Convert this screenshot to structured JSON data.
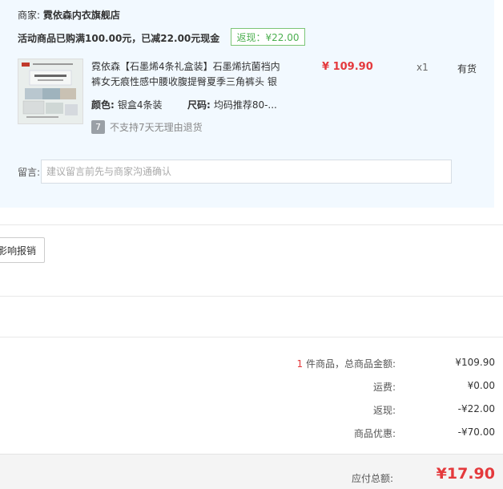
{
  "store": {
    "label": "商家:",
    "name": "霓依森内衣旗舰店"
  },
  "promo": {
    "text": "活动商品已购满100.00元，已减22.00元现金",
    "badge": "返现：¥22.00"
  },
  "product": {
    "title": "霓依森【石墨烯4条礼盒装】石墨烯抗菌裆内裤女无痕性感中腰收腹提臀夏季三角裤头 银",
    "price": "¥ 109.90",
    "qty": "x1",
    "stock": "有货",
    "color_label": "颜色:",
    "color_value": "银盒4条装",
    "size_label": "尺码:",
    "size_value": "均码推荐80-...",
    "return_icon_text": "7",
    "return_text": "不支持7天无理由退货"
  },
  "note": {
    "label": "留言:",
    "placeholder": "建议留言前先与商家沟通确认"
  },
  "invoice": {
    "button_label": "影响报销"
  },
  "summary": {
    "count": "1",
    "items_label": " 件商品，总商品金额:",
    "items_value": "¥109.90",
    "shipping_label": "运费:",
    "shipping_value": "¥0.00",
    "cashback_label": "返现:",
    "cashback_value": "-¥22.00",
    "discount_label": "商品优惠:",
    "discount_value": "-¥70.00",
    "total_label": "应付总额:",
    "total_value": "¥17.90"
  },
  "colors": {
    "accent_red": "#e4393c",
    "cashback_green": "#4caf50",
    "panel_bg": "#f2f9ff"
  }
}
